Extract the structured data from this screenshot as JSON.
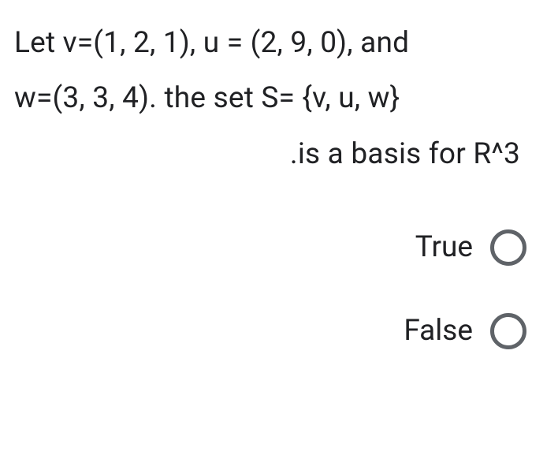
{
  "question": {
    "line1": "Let v=(1, 2, 1), u = (2, 9, 0), and",
    "line2": "w=(3, 3, 4). the set S= {v, u, w}",
    "line3": ".is a basis for R^3"
  },
  "options": [
    {
      "label": "True"
    },
    {
      "label": "False"
    }
  ]
}
